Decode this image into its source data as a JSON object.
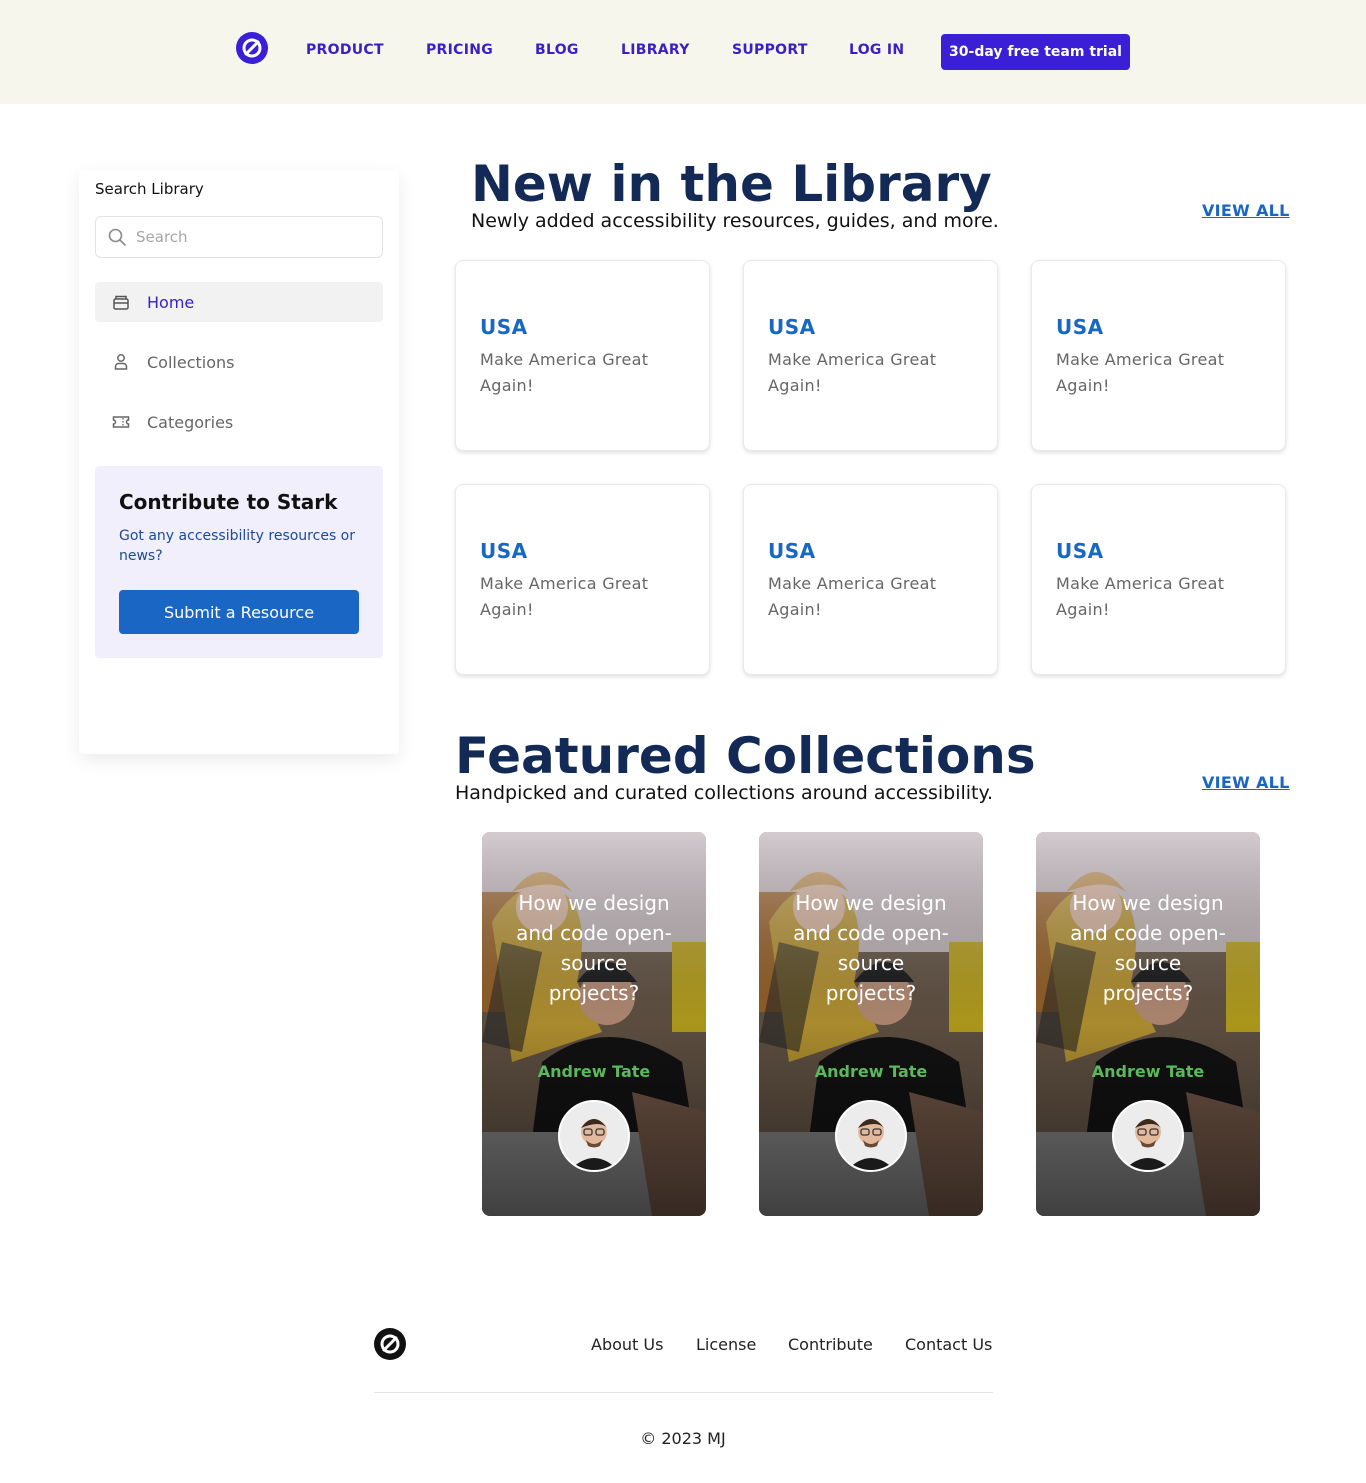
{
  "header": {
    "nav": [
      "PRODUCT",
      "PRICING",
      "BLOG",
      "LIBRARY",
      "SUPPORT",
      "LOG IN"
    ],
    "cta": "30-day free team trial",
    "brand_color": "#3a1fd6"
  },
  "sidebar": {
    "title": "Search Library",
    "search_placeholder": "Search",
    "items": [
      {
        "label": "Home",
        "icon": "inbox-icon",
        "active": true
      },
      {
        "label": "Collections",
        "icon": "user-icon",
        "active": false
      },
      {
        "label": "Categories",
        "icon": "ticket-icon",
        "active": false
      }
    ],
    "contribute": {
      "title": "Contribute to Stark",
      "text": "Got any accessibility resources or news?",
      "button": "Submit a Resource"
    }
  },
  "library": {
    "title": "New in the Library",
    "subtitle": "Newly added accessibility resources, guides, and more.",
    "view_all": "VIEW ALL",
    "cards": [
      {
        "title": "USA",
        "text": "Make America Great Again!"
      },
      {
        "title": "USA",
        "text": "Make America Great Again!"
      },
      {
        "title": "USA",
        "text": "Make America Great Again!"
      },
      {
        "title": "USA",
        "text": "Make America Great Again!"
      },
      {
        "title": "USA",
        "text": "Make America Great Again!"
      },
      {
        "title": "USA",
        "text": "Make America Great Again!"
      }
    ]
  },
  "collections": {
    "title": "Featured Collections",
    "subtitle": "Handpicked and curated collections around accessibility.",
    "view_all": "VIEW ALL",
    "cards": [
      {
        "heading": "How we design and code open-source projects?",
        "author": "Andrew Tate"
      },
      {
        "heading": "How we design and code open-source projects?",
        "author": "Andrew Tate"
      },
      {
        "heading": "How we design and code open-source projects?",
        "author": "Andrew Tate"
      }
    ]
  },
  "footer": {
    "links": [
      "About Us",
      "License",
      "Contribute",
      "Contact Us"
    ],
    "copyright": "© 2023 MJ"
  }
}
